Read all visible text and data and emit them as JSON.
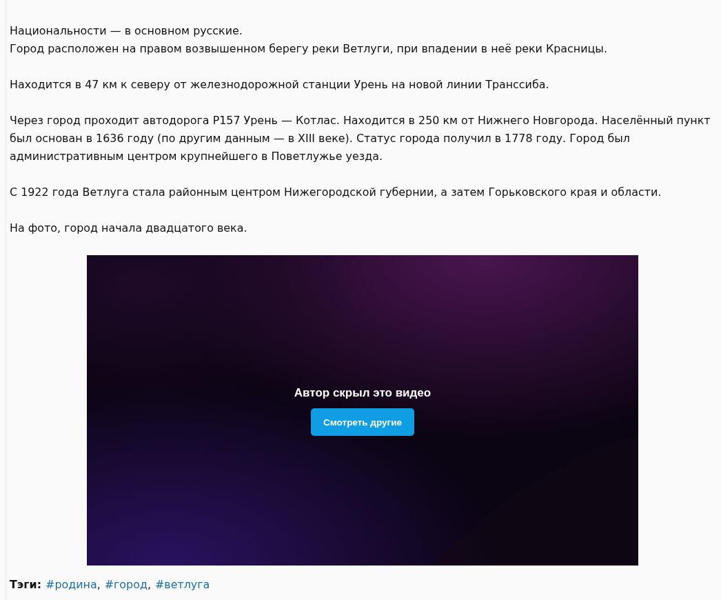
{
  "paragraphs": [
    {
      "lines": [
        "Национальности — в основном русские.",
        "Город расположен на правом возвышенном берегу реки Ветлуги, при впадении в неё реки Красницы."
      ]
    },
    {
      "lines": [
        "Находится в 47 км к северу от железнодорожной станции Урень на новой линии Транссиба."
      ]
    },
    {
      "lines": [
        "Через город проходит автодорога Р157 Урень — Котлас. Находится в 250 км от Нижнего Новгорода. Населённый пункт",
        "был основан в 1636 году (по другим данным — в XIII веке). Статус города получил в 1778 году. Город был",
        "административным центром крупнейшего в Поветлужье уезда."
      ]
    },
    {
      "lines": [
        "С 1922 года Ветлуга стала районным центром Нижегородской губернии, а затем Горьковского края и области."
      ]
    },
    {
      "lines": [
        "На фото, город начала двадцатого века."
      ]
    }
  ],
  "video": {
    "message": "Автор скрыл это видео",
    "button": "Смотреть другие"
  },
  "tags": {
    "label": "Тэги:",
    "separator": ",",
    "items": [
      "#родина",
      "#город",
      "#ветлуга"
    ]
  }
}
